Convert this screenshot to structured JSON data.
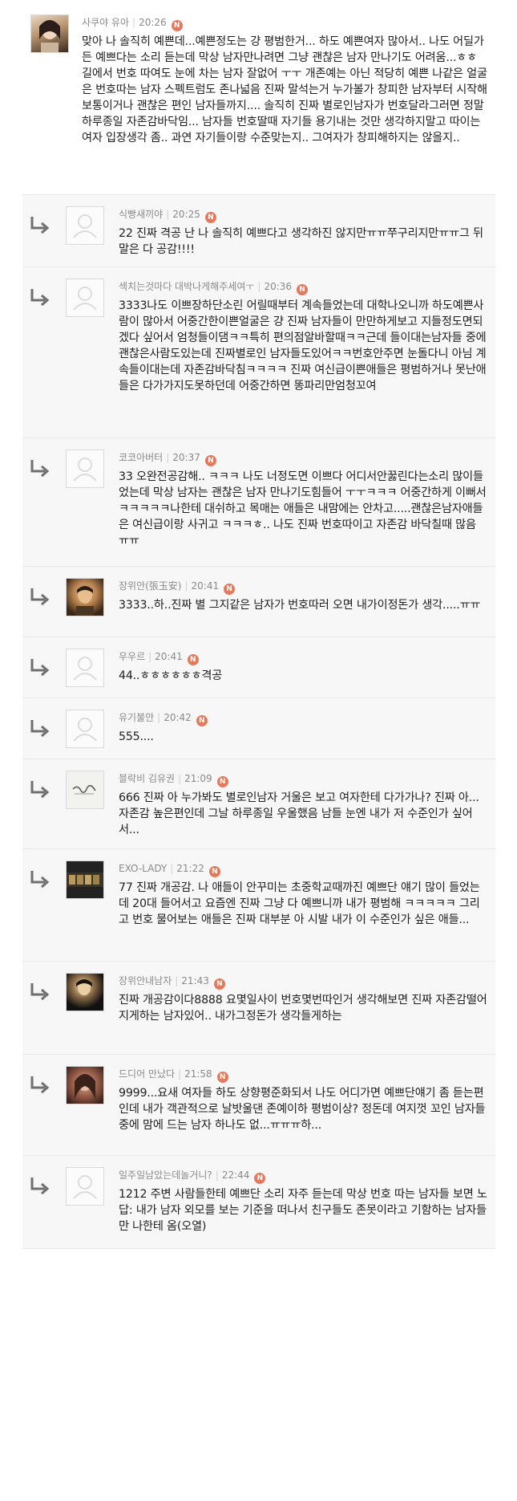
{
  "comments": [
    {
      "author": "사쿠야 유아",
      "time": "20:26",
      "badge": "N",
      "avatar_icon": "girl-photo-avatar",
      "text": "맞아 나 솔직히 예쁜데...예쁜정도는 걍 평범한거... 하도 예쁜여자 많아서.. 나도 어딜가든 예쁘다는 소리 듣는데 막상 남자만나려면 그냥 괜찮은 남자 만나기도 어려움...ㅎㅎ 길에서 번호 따여도 눈에 차는 남자 잘없어 ㅜㅜ 개존예는 아닌 적당히 예쁜 나같은 얼굴은 번호따는 남자 스펙트럼도 존나넓음 진짜 말석는거 누가볼가 창피한 남자부터 시작해 보통이거나 괜찮은 편인 남자들까지.... 솔직히 진짜 별로인남자가 번호달라그러면 정말 하루종일 자존감바닥임... 남자들 번호딸때 자기들 용기내는 것만 생각하지말고 따이는 여자 입장생각 좀.. 과연 자기들이랑 수준맞는지.. 그여자가 창피해하지는 않을지.."
    },
    {
      "author": "식빵새끼야",
      "time": "20:25",
      "badge": "N",
      "avatar_icon": "default-user-avatar",
      "text": "22 진짜 격공 난 나 솔직히 예쁘다고 생각하진 않지만ㅠㅠ쭈구리지만ㅠㅠ그 뒤 말은 다 공감!!!!"
    },
    {
      "author": "섹치는것마다 대박나게해주세여ㅜ",
      "time": "20:36",
      "badge": "N",
      "avatar_icon": "default-user-avatar",
      "text": "3333나도 이쁘장하단소린 어릴때부터 계속들었는데 대학나오니까 하도예쁜사람이 많아서 어중간한이쁜얼굴은 걍 진짜 남자들이 만만하게보고 지들정도면되겠다 싶어서 엄청들이댐ㅋㅋ특히 편의점알바할때ㅋㅋ근데 들이대는남자들 중에 괜찮은사람도있는데 진짜별로인 남자들도있어ㅋㅋ번호안주면 눈돌다니 아님 계속들이대는데 자존감바닥침ㅋㅋㅋㅋ 진짜 여신급이쁜애들은 평범하거나 못난애들은 다가가지도못하던데 어중간하면 똥파리만엄청꼬여"
    },
    {
      "author": "코코아버터",
      "time": "20:37",
      "badge": "N",
      "avatar_icon": "default-user-avatar",
      "text": "33 오완전공감해.. ㅋㅋㅋ 나도 너정도면 이쁘다 어디서안꿇린다는소리 많이들었는데 막상 남자는 괜찮은 남자 만나기도힘들어 ㅜㅜㅋㅋㅋ 어중간하게 이뻐서 ㅋㅋㅋㅋㅋ나한테 대쉬하고 목매는 애들은 내맘에는 안차고.....괜찮은남자애들은 여신급이랑 사귀고 ㅋㅋㅋㅎ.. 나도 진짜 번호따이고 자존감 바닥칠때 많음 ㅠㅠ"
    },
    {
      "author": "장위안(張玉安)",
      "time": "20:41",
      "badge": "N",
      "avatar_icon": "man-photo-avatar",
      "text": "3333..하..진짜 별 그지같은 남자가 번호따러 오면 내가이정돈가 생각.....ㅠㅠ"
    },
    {
      "author": "우우르",
      "time": "20:41",
      "badge": "N",
      "avatar_icon": "default-user-avatar",
      "text": "44..ㅎㅎㅎㅎㅎㅎ격공"
    },
    {
      "author": "유기불안",
      "time": "20:42",
      "badge": "N",
      "avatar_icon": "default-user-avatar",
      "text": "555...."
    },
    {
      "author": "블락비 김유권",
      "time": "21:09",
      "badge": "N",
      "avatar_icon": "calligraphy-avatar",
      "text": "666 진짜 아 누가봐도 별로인남자 거울은 보고 여자한테 다가가나? 진짜 아... 자존감 높은편인데 그날 하루종일 우울했음 남들 눈엔 내가 저 수준인가 싶어서..."
    },
    {
      "author": "EXO-LADY",
      "time": "21:22",
      "badge": "N",
      "avatar_icon": "exo-banner-avatar",
      "text": "77 진짜 개공감. 나 애들이 안꾸미는 초중학교때까진 예쁘단 얘기 많이 들었는데 20대 들어서고 요즘엔 진짜 그냥 다 예쁘니까 내가 평범해 ㅋㅋㅋㅋㅋ 그리고 번호 물어보는 애들은 진짜 대부분 아 시발 내가 이 수준인가 싶은 애들..."
    },
    {
      "author": "장위안내남자",
      "time": "21:43",
      "badge": "N",
      "avatar_icon": "dark-photo-avatar",
      "text": "진짜 개공감이다8888 요몇일사이 번호몇번따인거 생각해보면 진짜 자존감떨어지게하는 남자있어.. 내가그정돈가 생각들게하는"
    },
    {
      "author": "드디어 만났다",
      "time": "21:58",
      "badge": "N",
      "avatar_icon": "woman-photo-avatar",
      "text": "9999...요새 여자들 하도 상향평준화되서 나도 어디가면 예쁘단얘기 좀 듣는편인데 내가 객관적으로 날밧울댄 존예이하 평범이상? 정돈데 여지껏 꼬인 남자들중에 맘에 드는 남자 하나도 없...ㅠㅠㅠ하..."
    },
    {
      "author": "일주일남았는데놀거니?",
      "time": "22:44",
      "badge": "N",
      "avatar_icon": "default-user-avatar",
      "text": "1212 주변 사람들한테 예쁘단 소리 자주 듣는데 막상 번호 따는 남자들 보면 노답: 내가 남자 외모를 보는 기준을 떠나서 친구들도 존못이라고 기함하는 남자들만 나한테 옴(오열)"
    }
  ]
}
